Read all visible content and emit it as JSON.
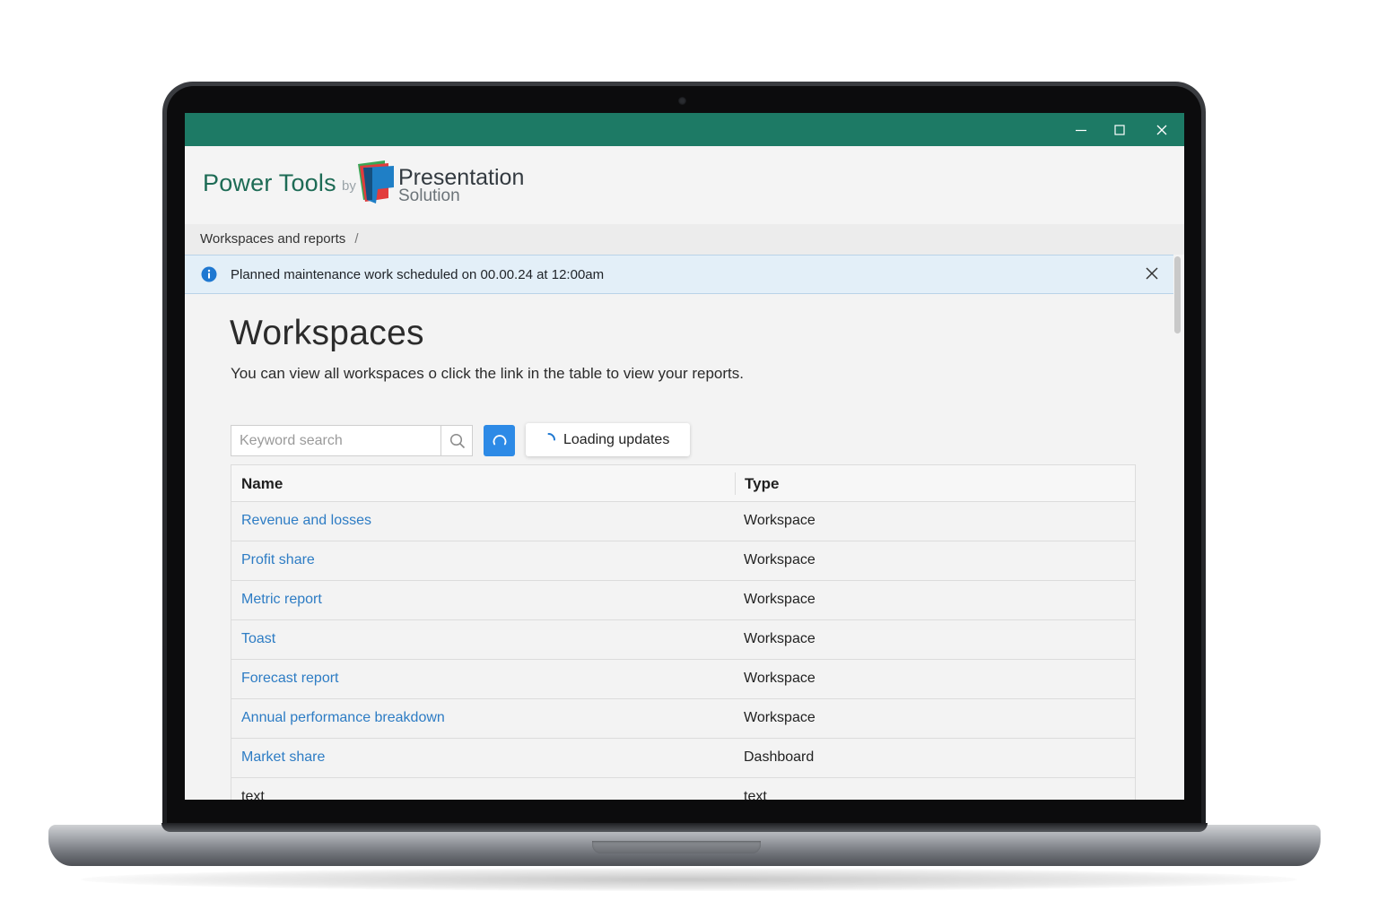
{
  "window": {
    "minimize_icon": "minimize-icon",
    "maximize_icon": "maximize-icon",
    "close_icon": "close-icon",
    "titlebar_color": "#1d7a65"
  },
  "brand": {
    "product": "Power Tools",
    "by": "by",
    "company_line1": "Presentation",
    "company_line2": "Solution",
    "logo_icon": "presentation-solution-logo"
  },
  "breadcrumb": {
    "item": "Workspaces and reports",
    "separator": "/"
  },
  "banner": {
    "icon": "info-icon",
    "text": "Planned maintenance work scheduled on 00.00.24 at 12:00am",
    "close_icon": "close-icon",
    "color": "#e3eff8"
  },
  "page": {
    "title": "Workspaces",
    "description": "You can view all workspaces o click the link in the table to view your reports."
  },
  "toolbar": {
    "search_placeholder": "Keyword search",
    "search_value": "",
    "search_icon": "search-icon",
    "refresh_icon": "refresh-icon",
    "loading_text": "Loading updates",
    "accent": "#2d8ae6"
  },
  "table": {
    "columns": [
      "Name",
      "Type"
    ],
    "rows": [
      {
        "name": "Revenue and losses",
        "type": "Workspace",
        "link": true
      },
      {
        "name": "Profit share",
        "type": "Workspace",
        "link": true
      },
      {
        "name": "Metric report",
        "type": "Workspace",
        "link": true
      },
      {
        "name": "Toast",
        "type": "Workspace",
        "link": true
      },
      {
        "name": "Forecast report",
        "type": "Workspace",
        "link": true
      },
      {
        "name": "Annual performance breakdown",
        "type": "Workspace",
        "link": true
      },
      {
        "name": "Market share",
        "type": "Dashboard",
        "link": true
      },
      {
        "name": "text",
        "type": "text",
        "link": false
      }
    ],
    "link_color": "#2d7cc4"
  }
}
